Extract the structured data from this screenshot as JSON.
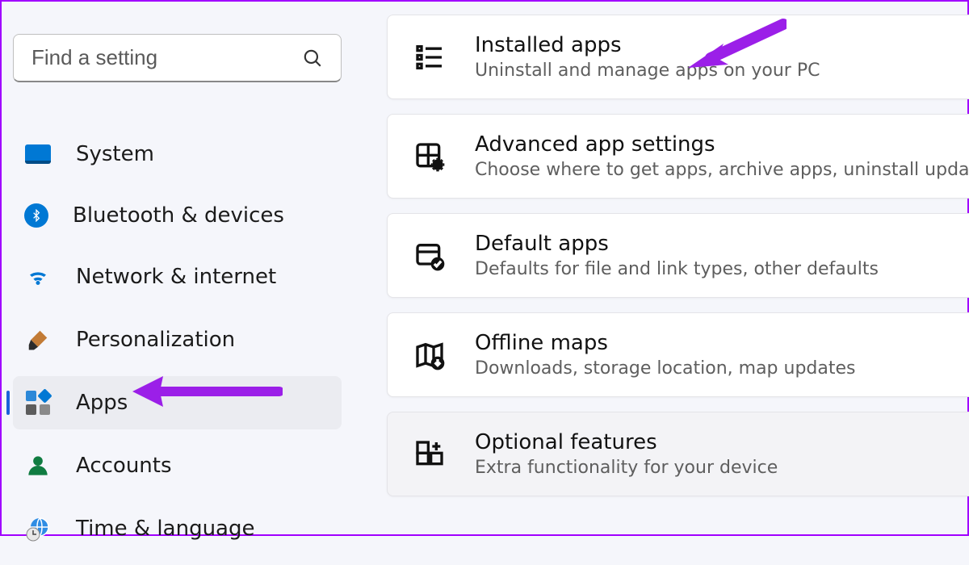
{
  "search": {
    "placeholder": "Find a setting"
  },
  "sidebar": {
    "items": [
      {
        "label": "System"
      },
      {
        "label": "Bluetooth & devices"
      },
      {
        "label": "Network & internet"
      },
      {
        "label": "Personalization"
      },
      {
        "label": "Apps"
      },
      {
        "label": "Accounts"
      },
      {
        "label": "Time & language"
      }
    ],
    "active_index": 4
  },
  "main": {
    "cards": [
      {
        "title": "Installed apps",
        "subtitle": "Uninstall and manage apps on your PC"
      },
      {
        "title": "Advanced app settings",
        "subtitle": "Choose where to get apps, archive apps, uninstall updates"
      },
      {
        "title": "Default apps",
        "subtitle": "Defaults for file and link types, other defaults"
      },
      {
        "title": "Offline maps",
        "subtitle": "Downloads, storage location, map updates"
      },
      {
        "title": "Optional features",
        "subtitle": "Extra functionality for your device"
      }
    ]
  },
  "annotations": {
    "arrow_color": "#9b1fe8"
  }
}
